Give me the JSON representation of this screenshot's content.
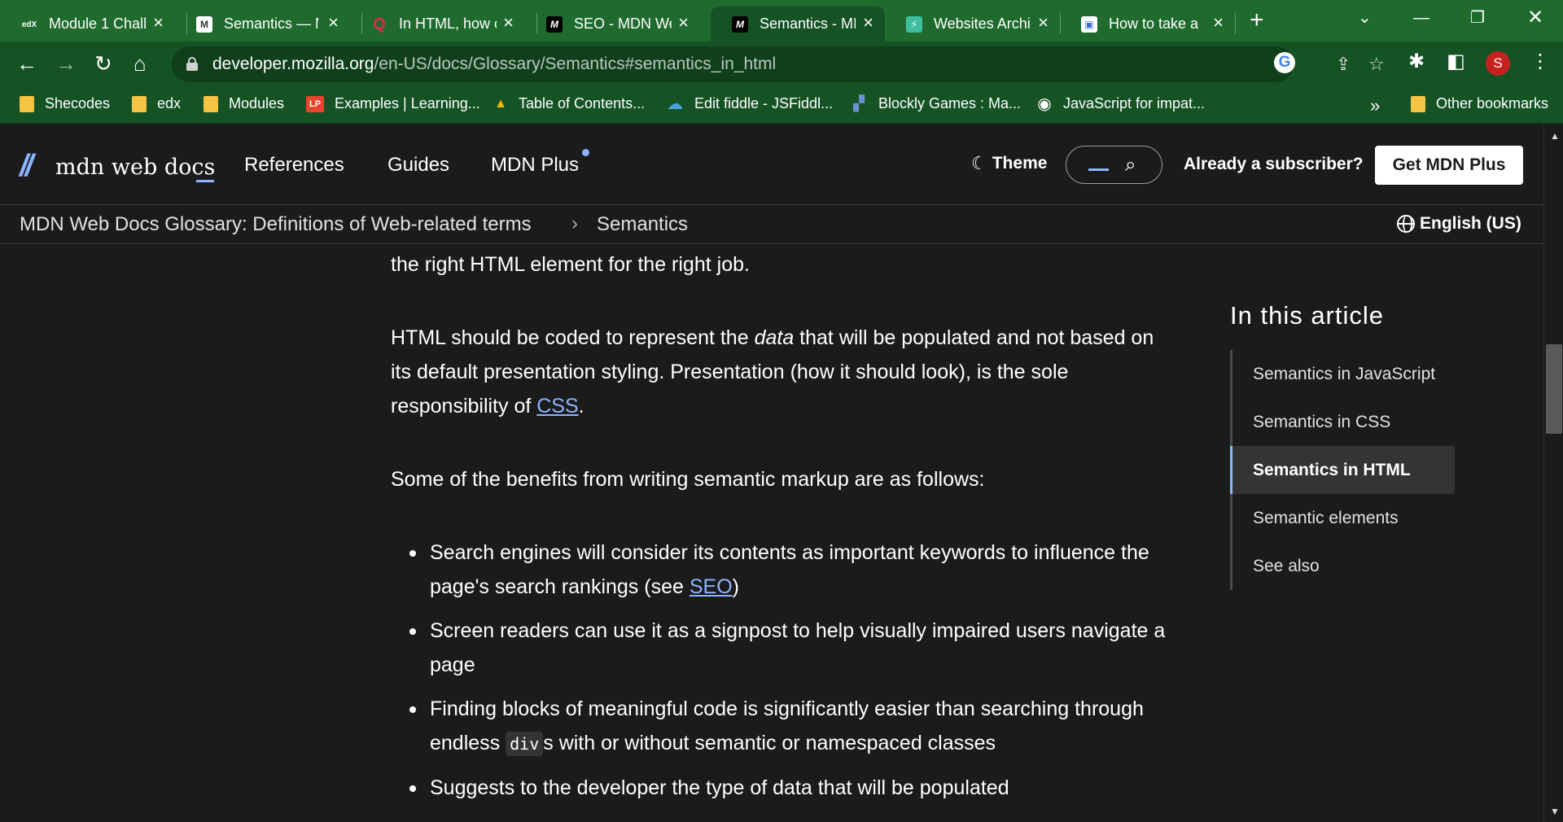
{
  "tabs": [
    {
      "title": "Module 1 Chall",
      "favicon": "edx-icon",
      "fav_text": "edX",
      "fav_bg": "transparent",
      "fav_color": "#ffffff",
      "active": false
    },
    {
      "title": "Semantics — M",
      "favicon": "mdn-m-icon",
      "fav_text": "M",
      "fav_bg": "#ffffff",
      "fav_color": "#333333",
      "active": false
    },
    {
      "title": "In HTML, how c",
      "favicon": "quora-icon",
      "fav_text": "Q",
      "fav_bg": "transparent",
      "fav_color": "#e0284b",
      "active": false
    },
    {
      "title": "SEO - MDN We",
      "favicon": "mdn-logo-icon",
      "fav_text": "M",
      "fav_bg": "#000000",
      "fav_color": "#ffffff",
      "active": false
    },
    {
      "title": "Semantics - MI",
      "favicon": "mdn-logo-icon",
      "fav_text": "M",
      "fav_bg": "#000000",
      "fav_color": "#ffffff",
      "active": true
    },
    {
      "title": "Websites Archi",
      "favicon": "bolt-icon",
      "fav_text": "⚡",
      "fav_bg": "#3fbfa0",
      "fav_color": "#ffffff",
      "active": false
    },
    {
      "title": "How to take a",
      "favicon": "screenshot-icon",
      "fav_text": "▣",
      "fav_bg": "#ffffff",
      "fav_color": "#3b6fd6",
      "active": false
    }
  ],
  "address": {
    "host": "developer.mozilla.org",
    "path": "/en-US/docs/Glossary/Semantics#semantics_in_html"
  },
  "profile": {
    "initial": "S",
    "color": "#c5221f"
  },
  "bookmarks": [
    {
      "label": "Shecodes",
      "icon": "folder-icon",
      "icon_text": "",
      "icon_bg": "#f6c445"
    },
    {
      "label": "edx",
      "icon": "folder-icon",
      "icon_text": "",
      "icon_bg": "#f6c445"
    },
    {
      "label": "Modules",
      "icon": "folder-icon",
      "icon_text": "",
      "icon_bg": "#f6c445"
    },
    {
      "label": "Examples | Learning...",
      "icon": "lp-icon",
      "icon_text": "LP",
      "icon_bg": "#e8442e"
    },
    {
      "label": "Table of Contents...",
      "icon": "drive-icon",
      "icon_text": "▲",
      "icon_bg": "transparent"
    },
    {
      "label": "Edit fiddle - JSFiddl...",
      "icon": "cloud-icon",
      "icon_text": "☁",
      "icon_bg": "transparent"
    },
    {
      "label": "Blockly Games : Ma...",
      "icon": "puzzle-icon",
      "icon_text": "▞",
      "icon_bg": "transparent"
    },
    {
      "label": "JavaScript for impat...",
      "icon": "globe-icon",
      "icon_text": "◉",
      "icon_bg": "transparent"
    }
  ],
  "bookmarks_overflow": "»",
  "other_bookmarks": "Other bookmarks",
  "mdn": {
    "logo_text": "mdn web docs",
    "nav": [
      "References",
      "Guides",
      "MDN Plus"
    ],
    "theme_label": "Theme",
    "subscriber_label": "Already a subscriber?",
    "get_plus_label": "Get MDN Plus",
    "breadcrumb": [
      "MDN Web Docs Glossary: Definitions of Web-related terms",
      "Semantics"
    ],
    "breadcrumb_sep": "›",
    "language": "English (US)",
    "accent": "#8cb4ff"
  },
  "article": {
    "para1": "the right HTML element for the right job.",
    "para2_a": "HTML should be coded to represent the ",
    "para2_em": "data",
    "para2_b": " that will be populated and not based on its default presentation styling. Presentation (how it should look), is the sole responsibility of ",
    "para2_link": "CSS",
    "para2_c": ".",
    "para3": "Some of the benefits from writing semantic markup are as follows:",
    "bullet1_a": "Search engines will consider its contents as important keywords to influence the page's search rankings (see ",
    "bullet1_link": "SEO",
    "bullet1_b": ")",
    "bullet2": "Screen readers can use it as a signpost to help visually impaired users navigate a page",
    "bullet3_a": "Finding blocks of meaningful code is significantly easier than searching through endless ",
    "bullet3_code": "div",
    "bullet3_b": "s with or without semantic or namespaced classes",
    "bullet4": "Suggests to the developer the type of data that will be populated"
  },
  "toc": {
    "title": "In this article",
    "items": [
      "Semantics in JavaScript",
      "Semantics in CSS",
      "Semantics in HTML",
      "Semantic elements",
      "See also"
    ],
    "active_index": 2
  }
}
